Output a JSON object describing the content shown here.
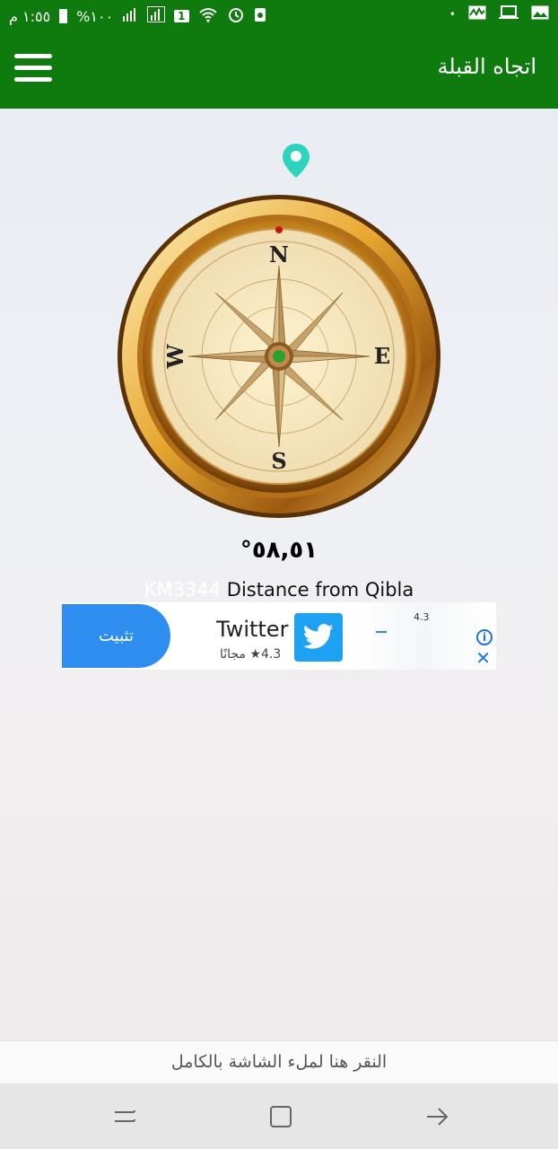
{
  "status_bar": {
    "time": "١:٥٥ م",
    "battery": "%١٠٠",
    "sim_slot": "1",
    "dot": "•"
  },
  "app_bar": {
    "title": "اتجاه القبلة"
  },
  "compass": {
    "north": "N",
    "south": "S",
    "east": "E",
    "west": "W"
  },
  "qibla": {
    "degree": "٥٨,٥١°",
    "distance_value": "KM3344",
    "distance_label": "Distance from Qibla"
  },
  "ad": {
    "install_label": "تثبيت",
    "app_name": "Twitter",
    "rating_text": "4.3★ مجانًا",
    "right_rating": "4.3",
    "info": "i",
    "close": "✕"
  },
  "fullscreen_text": "النقر هنا لملء الشاشة بالكامل",
  "colors": {
    "primary": "#0f7a0d",
    "install_button": "#2e8ef0",
    "pin": "#2cd4bd"
  }
}
